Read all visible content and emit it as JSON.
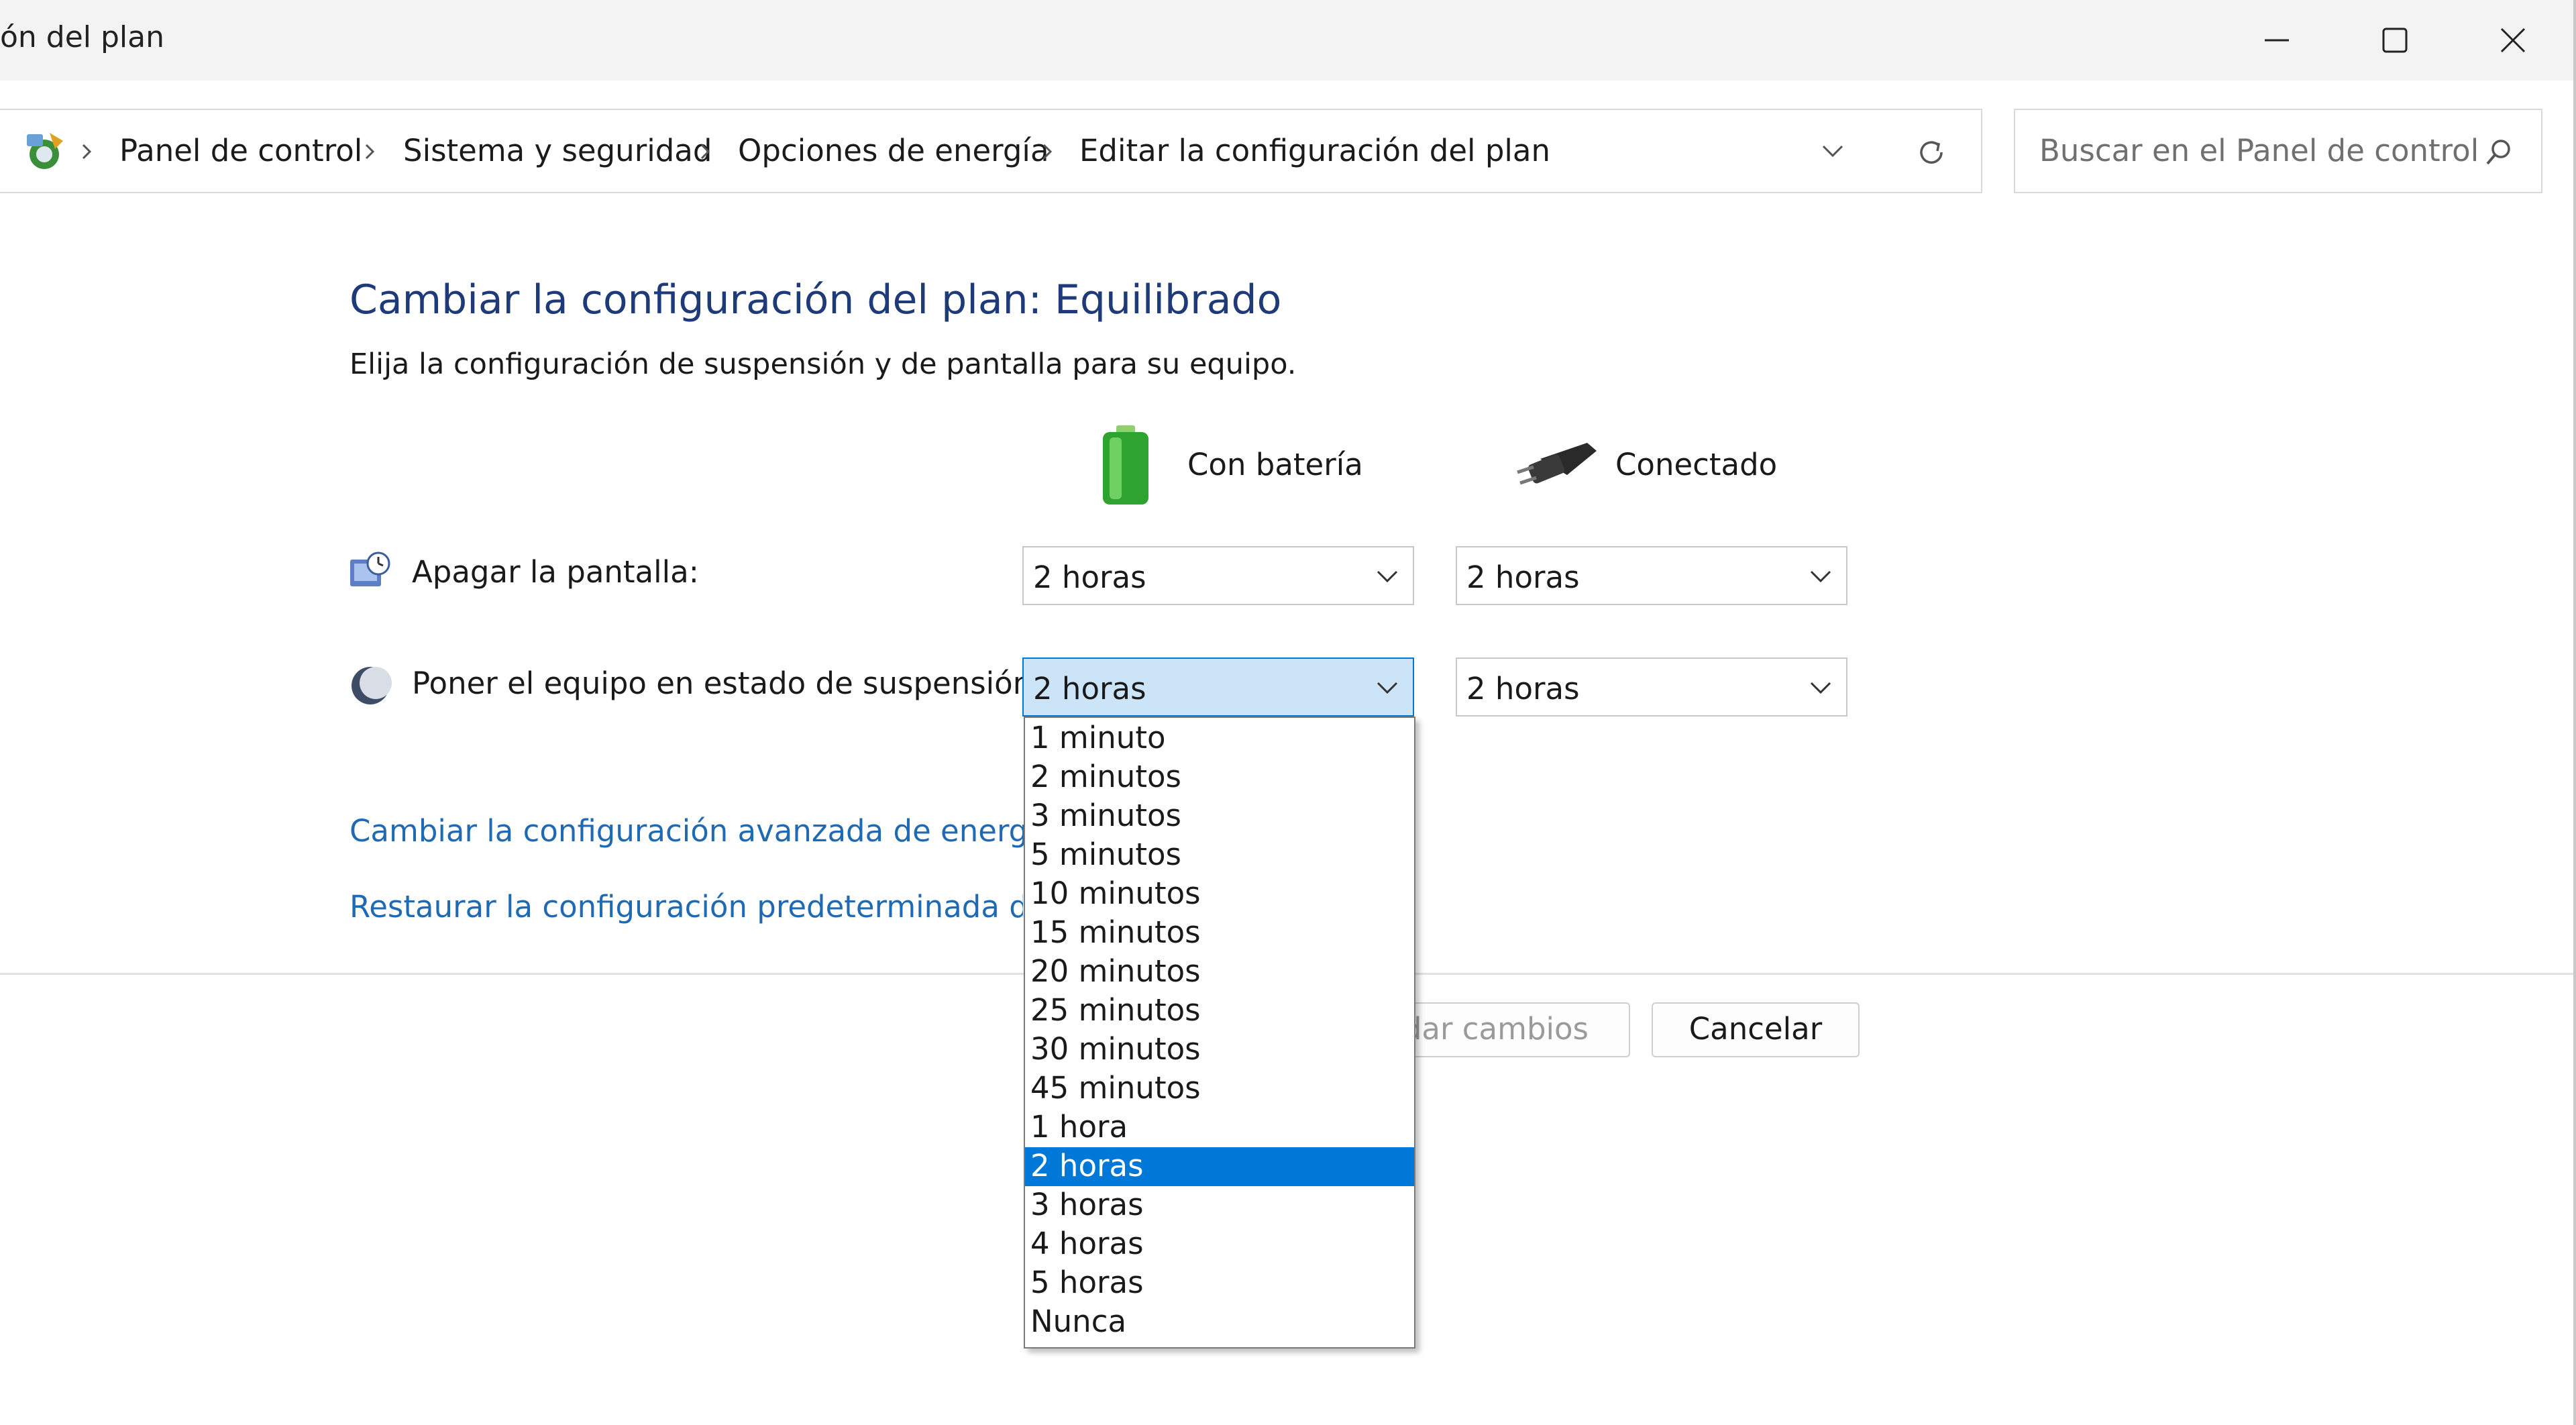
{
  "window": {
    "title": "ón del plan",
    "minimize_icon": "minimize-icon",
    "maximize_icon": "maximize-icon",
    "close_icon": "close-icon"
  },
  "address": {
    "home_icon": "control-panel-icon",
    "breadcrumbs": [
      "Panel de control",
      "Sistema y seguridad",
      "Opciones de energía",
      "Editar la configuración del plan"
    ],
    "search_placeholder": "Buscar en el Panel de control"
  },
  "main": {
    "heading": "Cambiar la configuración del plan: Equilibrado",
    "subtitle": "Elija la configuración de suspensión y de pantalla para su equipo.",
    "col_battery": "Con batería",
    "col_plugged": "Conectado",
    "rows": [
      {
        "label": "Apagar la pantalla:",
        "battery": "2 horas",
        "plugged": "2 horas"
      },
      {
        "label": "Poner el equipo en estado de suspensión:",
        "battery": "2 horas",
        "plugged": "2 horas"
      }
    ],
    "link_advanced": "Cambiar la configuración avanzada de energía",
    "link_restore": "Restaurar la configuración predeterminada de est"
  },
  "footer": {
    "save_label": "dar cambios",
    "cancel_label": "Cancelar"
  },
  "dropdown": {
    "options": [
      "1 minuto",
      "2 minutos",
      "3 minutos",
      "5 minutos",
      "10 minutos",
      "15 minutos",
      "20 minutos",
      "25 minutos",
      "30 minutos",
      "45 minutos",
      "1 hora",
      "2 horas",
      "3 horas",
      "4 horas",
      "5 horas",
      "Nunca"
    ],
    "selected_index": 11
  },
  "colors": {
    "heading": "#1e3a78",
    "link": "#1f6ab3",
    "selection": "#0078d7",
    "active_select": "#cce4f7"
  }
}
